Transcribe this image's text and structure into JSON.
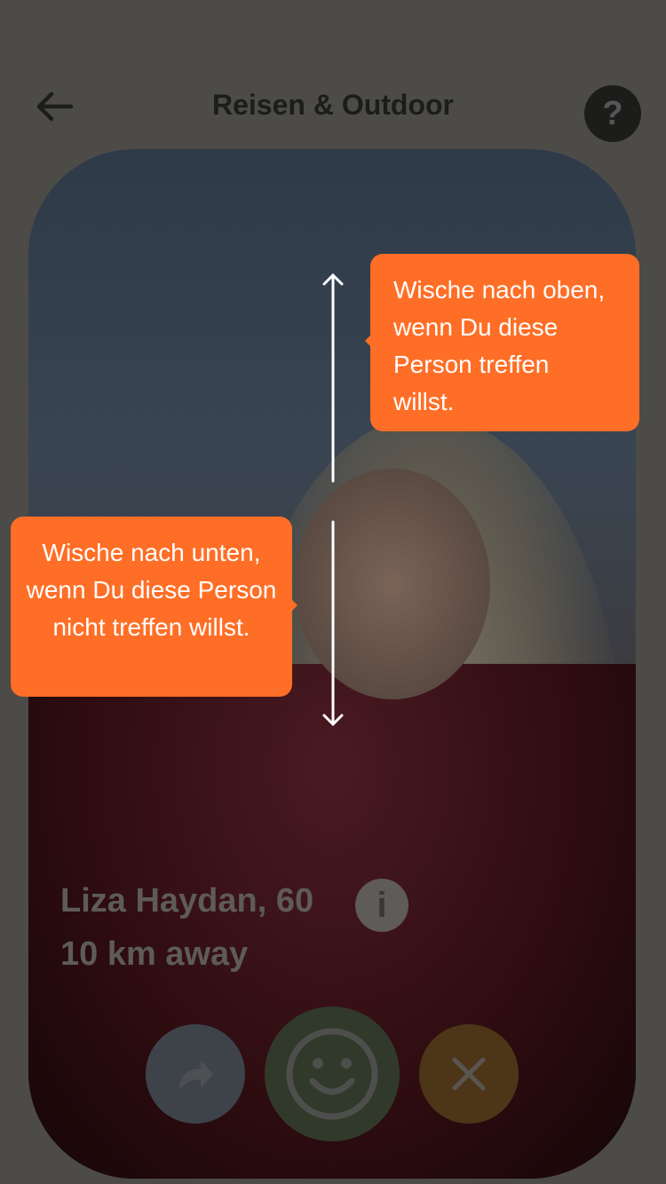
{
  "header": {
    "title": "Reisen & Outdoor",
    "help": "?"
  },
  "profile": {
    "name_age": "Liza Haydan, 60",
    "distance": "10 km away",
    "info": "i"
  },
  "tooltips": {
    "up": "Wische nach oben, wenn Du diese Person treffen willst.",
    "down": "Wische nach unten, wenn Du diese Person nicht treffen willst."
  },
  "colors": {
    "accent": "#ff6e26"
  }
}
